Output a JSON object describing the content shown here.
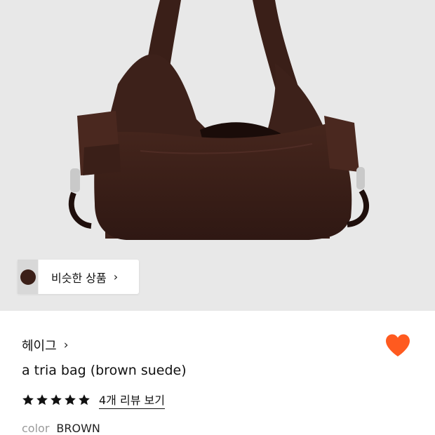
{
  "hero": {
    "background": "#e8e8e8",
    "image_subject": "brown suede shoulder bag"
  },
  "similar": {
    "label": "비슷한 상품",
    "chevron": "›"
  },
  "product": {
    "brand": "헤이그",
    "brand_chevron": "›",
    "title": "a tria bag (brown suede)",
    "rating_stars": 5,
    "review_link": "4개 리뷰 보기",
    "color_label": "color",
    "color_value": "BROWN",
    "favorite": true
  },
  "colors": {
    "heart": "#ff5a1f",
    "bag": "#3b2019"
  }
}
